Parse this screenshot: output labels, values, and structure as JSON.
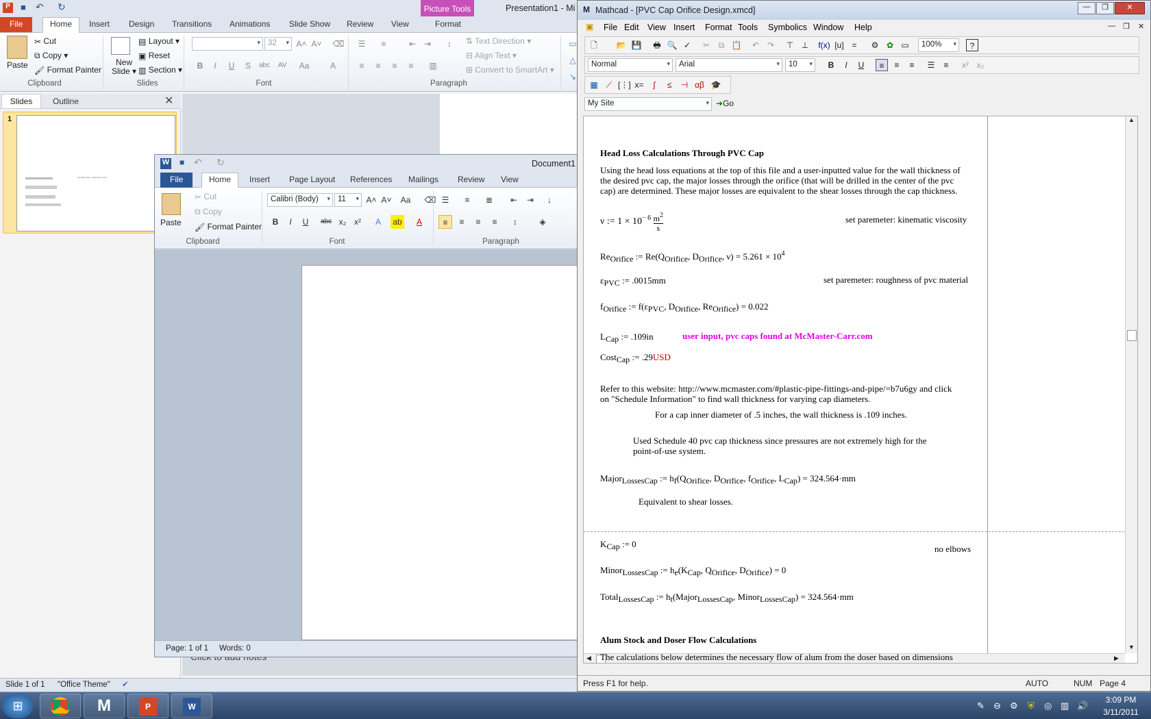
{
  "ppt": {
    "title": "Presentation1 - Mi",
    "file_tab": "File",
    "tabs": [
      "Home",
      "Insert",
      "Design",
      "Transitions",
      "Animations",
      "Slide Show",
      "Review",
      "View",
      "Format"
    ],
    "picture_tools": "Picture Tools",
    "clipboard": {
      "paste": "Paste",
      "cut": "Cut",
      "copy": "Copy",
      "format_painter": "Format Painter",
      "label": "Clipboard"
    },
    "slides_group": {
      "new_slide_1": "New",
      "new_slide_2": "Slide",
      "layout": "Layout",
      "reset": "Reset",
      "section": "Section",
      "label": "Slides"
    },
    "font_group": {
      "size": "32",
      "label": "Font"
    },
    "paragraph_group": {
      "text_direction": "Text Direction",
      "align_text": "Align Text",
      "convert": "Convert to SmartArt",
      "label": "Paragraph"
    },
    "pane_tabs": [
      "Slides",
      "Outline"
    ],
    "slide_number": "1",
    "slide_thumb_right": "set parameter: roughness of pvc",
    "notes": "Click to add notes",
    "status": {
      "slide": "Slide 1 of 1",
      "theme": "\"Office Theme\""
    }
  },
  "word": {
    "title": "Document1",
    "file_tab": "File",
    "tabs": [
      "Home",
      "Insert",
      "Page Layout",
      "References",
      "Mailings",
      "Review",
      "View"
    ],
    "clipboard": {
      "paste": "Paste",
      "cut": "Cut",
      "copy": "Copy",
      "format_painter": "Format Painter",
      "label": "Clipboard"
    },
    "font": {
      "name": "Calibri (Body)",
      "size": "11",
      "label": "Font"
    },
    "paragraph_label": "Paragraph",
    "status": {
      "page": "Page: 1 of 1",
      "words": "Words: 0"
    }
  },
  "mathcad": {
    "title": "Mathcad - [PVC Cap Orifice Design.xmcd]",
    "menu": [
      "File",
      "Edit",
      "View",
      "Insert",
      "Format",
      "Tools",
      "Symbolics",
      "Window",
      "Help"
    ],
    "zoom": "100%",
    "style": "Normal",
    "font": "Arial",
    "font_size": "10",
    "site": "My Site",
    "go": "Go",
    "status": {
      "help": "Press F1 for help.",
      "auto": "AUTO",
      "num": "NUM",
      "page": "Page 4"
    },
    "doc": {
      "heading1": "Head Loss Calculations Through PVC Cap",
      "para1_l1": "Using the head loss equations at the top of this file and a user-inputted value for the wall thickness of",
      "para1_l2": "the desired pvc cap, the major losses through the orifice (that will be drilled in the center of the pvc",
      "para1_l3": "cap) are determined. These major losses are equivalent to the shear losses through the cap thickness.",
      "nu_note": "set paremeter: kinematic viscosity",
      "re_value": "= 5.261 × 10",
      "re_exp": "4",
      "eps_value": ":= .0015mm",
      "eps_note": "set paremeter: roughness of pvc material",
      "f_value": "= 0.022",
      "lcap_value": ":= .109in",
      "lcap_note": "user input, pvc caps found at McMaster-Carr.com",
      "cost_value": ":= .29",
      "cost_unit": "USD",
      "refer_l1": "Refer to this website: http://www.mcmaster.com/#plastic-pipe-fittings-and-pipe/=b7u6gy and click",
      "refer_l2": "on \"Schedule Information\" to find wall thickness for varying cap diameters.",
      "inner_diam": "For a cap inner diameter of .5 inches, the wall thickness is .109 inches.",
      "sched_l1": "Used Schedule 40 pvc cap thickness since pressures are not extremely high for the",
      "sched_l2": "point-of-use system.",
      "major_value": "= 324.564·mm",
      "equiv": "Equivalent to shear losses.",
      "kcap_value": ":= 0",
      "no_elbows": "no elbows",
      "minor_value": "= 0",
      "total_value": "= 324.564·mm",
      "heading2": "Alum Stock and Doser Flow Calculations",
      "para2_l1": "The calculations below determines the necessary flow of alum from the doser based on dimensions"
    }
  },
  "taskbar": {
    "time": "3:09 PM",
    "date": "3/11/2011"
  },
  "colors": {
    "ppt_file": "#d24726",
    "word_file": "#2b5797",
    "picture_tools": "#c94fb8",
    "mc_note": "#e000e0",
    "usd": "#cc0000"
  }
}
